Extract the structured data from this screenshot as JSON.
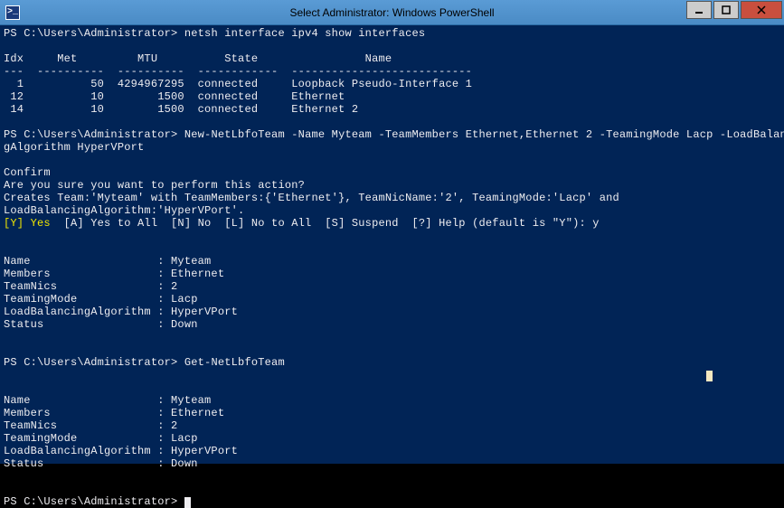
{
  "window": {
    "title": "Select Administrator: Windows PowerShell",
    "icon_glyph": ">_"
  },
  "prompt": "PS C:\\Users\\Administrator> ",
  "cmd1": "netsh interface ipv4 show interfaces",
  "ifaces_header": "Idx     Met         MTU          State                Name",
  "ifaces_divider": "---  ----------  ----------  ------------  ---------------------------",
  "ifaces_rows": [
    "  1          50  4294967295  connected     Loopback Pseudo-Interface 1",
    " 12          10        1500  connected     Ethernet",
    " 14          10        1500  connected     Ethernet 2"
  ],
  "cmd2_line1": "New-NetLbfoTeam -Name Myteam -TeamMembers Ethernet,Ethernet 2 -TeamingMode Lacp -LoadBalancin",
  "cmd2_line2": "gAlgorithm HyperVPort",
  "confirm": {
    "title": "Confirm",
    "question": "Are you sure you want to perform this action?",
    "detail1": "Creates Team:'Myteam' with TeamMembers:{'Ethernet'}, TeamNicName:'2', TeamingMode:'Lacp' and",
    "detail2": "LoadBalancingAlgorithm:'HyperVPort'.",
    "options_yes": "[Y] Yes",
    "options_rest": "  [A] Yes to All  [N] No  [L] No to All  [S] Suspend  [?] Help (default is \"Y\"): y"
  },
  "team_output": [
    "Name                   : Myteam",
    "Members                : Ethernet",
    "TeamNics               : 2",
    "TeamingMode            : Lacp",
    "LoadBalancingAlgorithm : HyperVPort",
    "Status                 : Down"
  ],
  "cmd3": "Get-NetLbfoTeam",
  "team_output2": [
    "Name                   : Myteam",
    "Members                : Ethernet",
    "TeamNics               : 2",
    "TeamingMode            : Lacp",
    "LoadBalancingAlgorithm : HyperVPort",
    "Status                 : Down"
  ]
}
